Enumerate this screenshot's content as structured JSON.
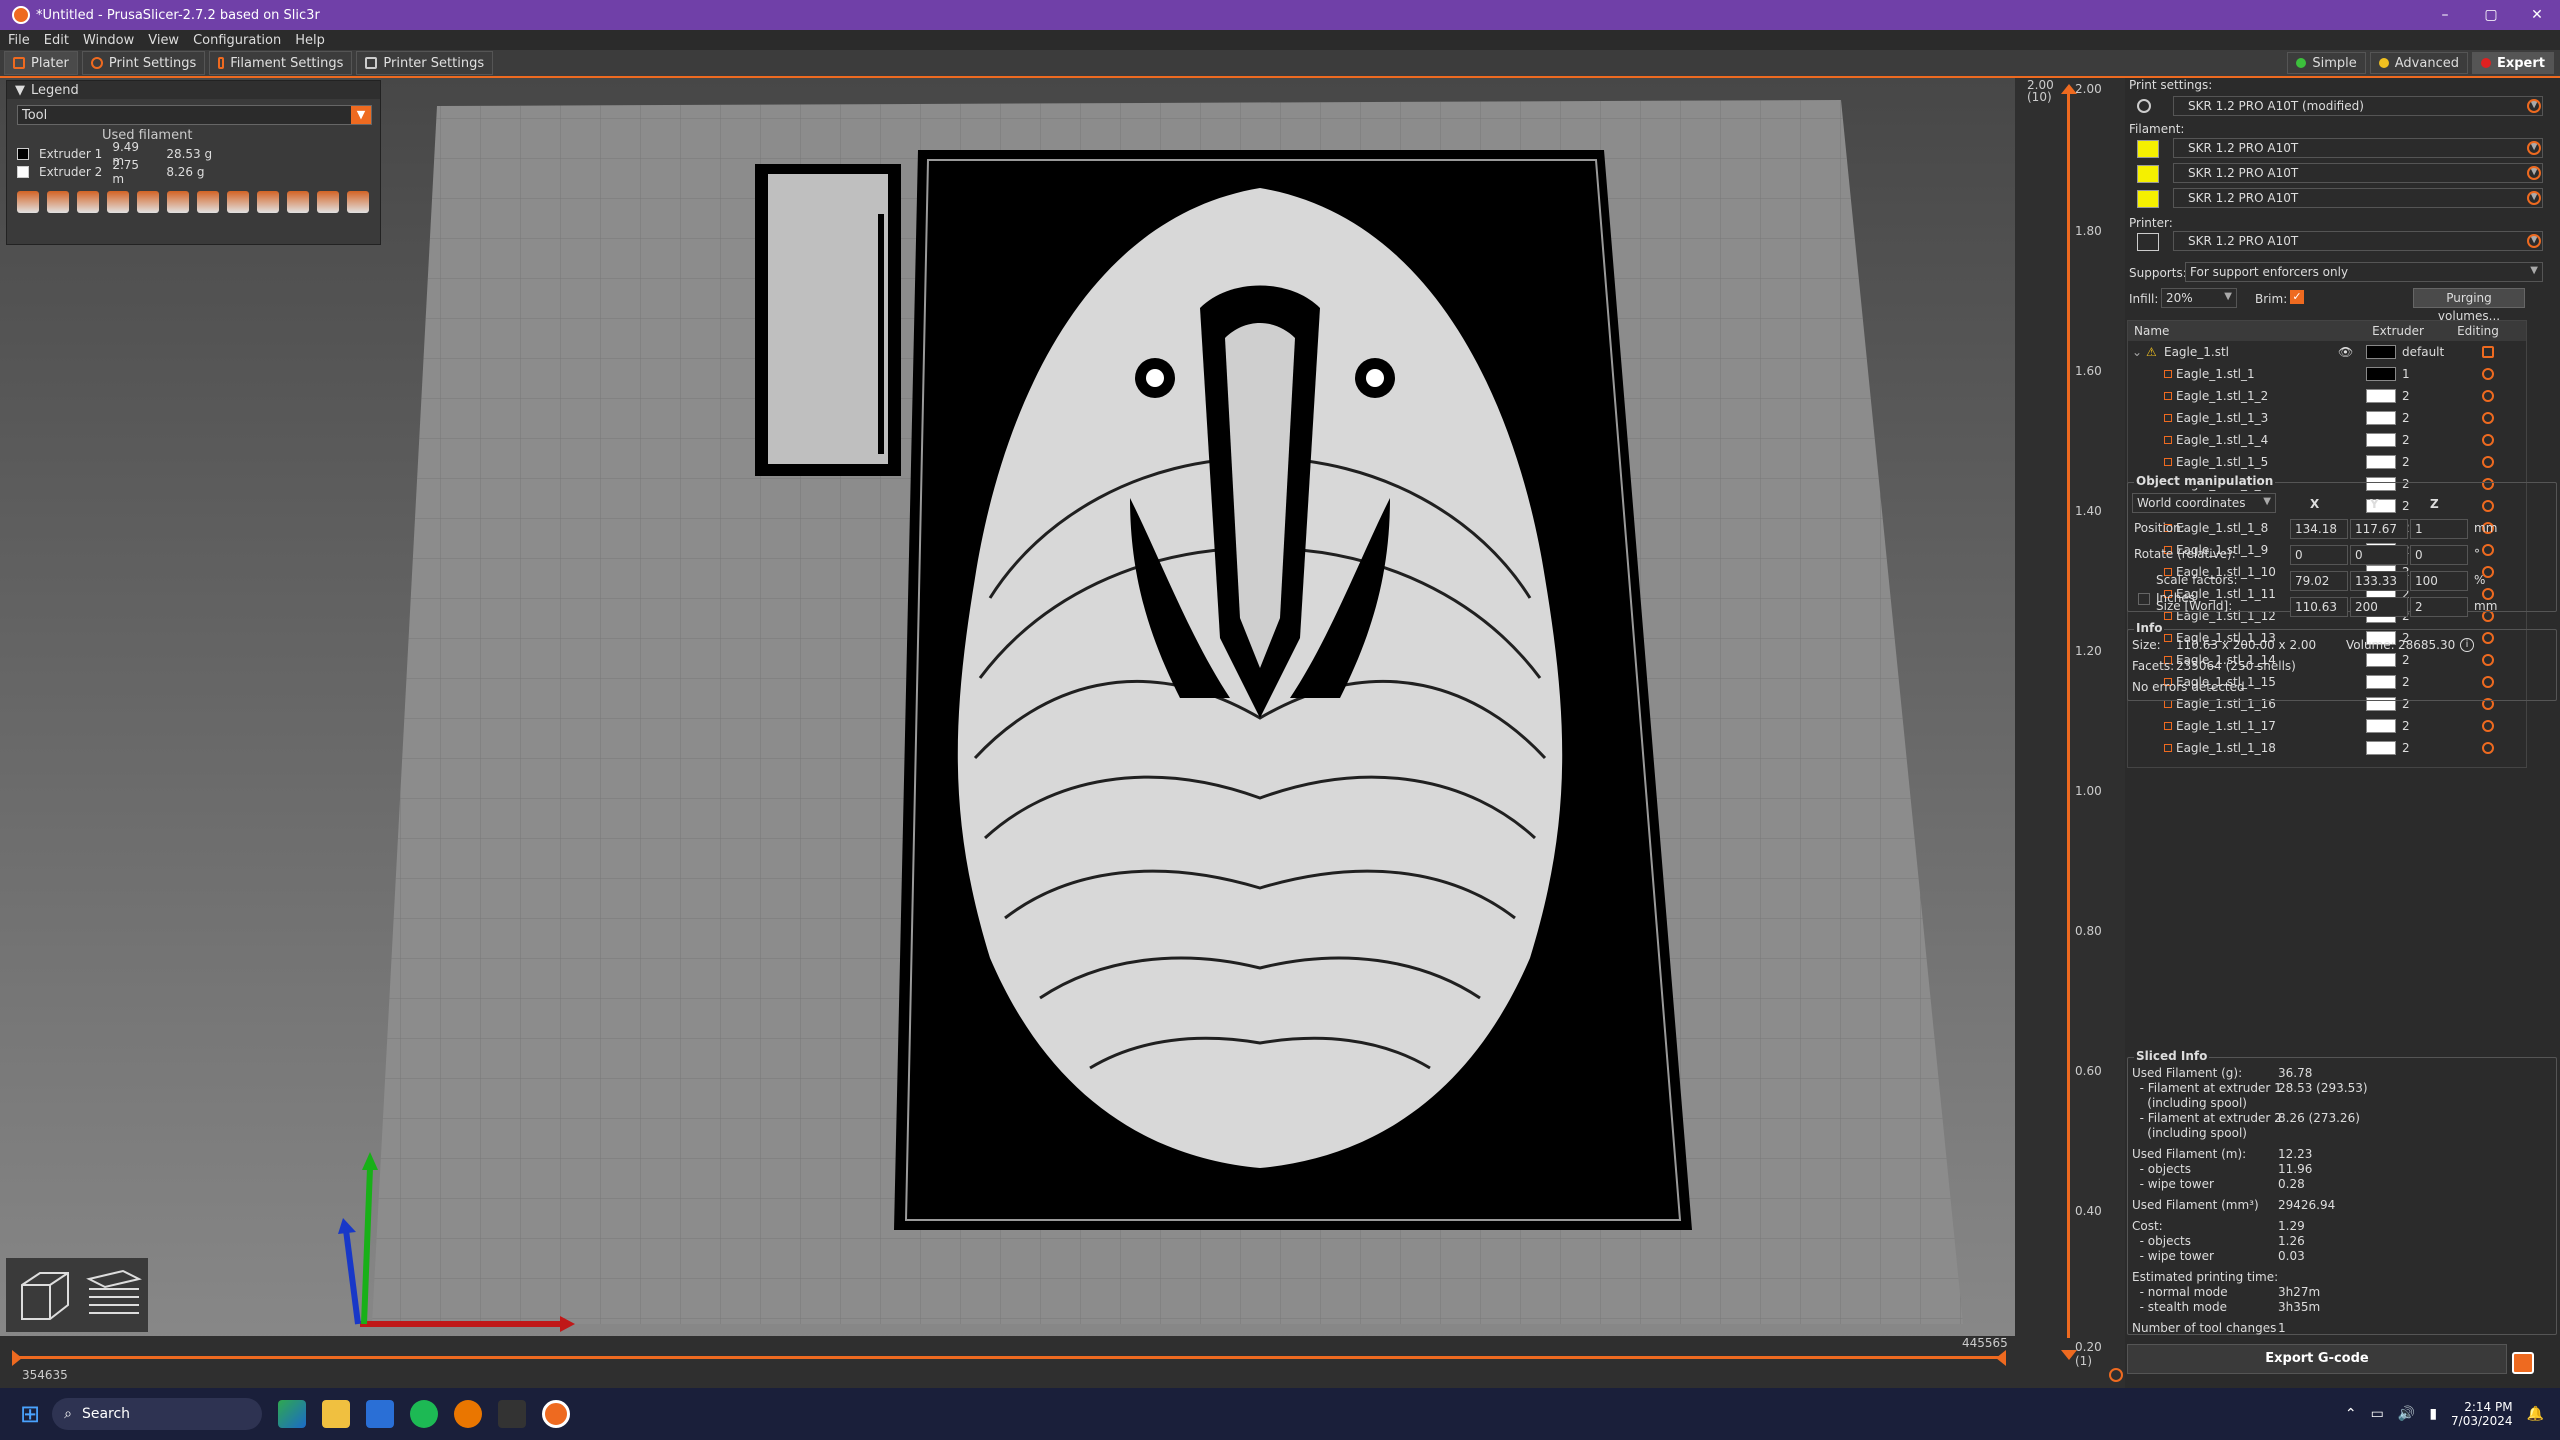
{
  "window": {
    "title": "*Untitled - PrusaSlicer-2.7.2 based on Slic3r",
    "minimize": "–",
    "maximize": "▢",
    "close": "✕"
  },
  "menu": [
    "File",
    "Edit",
    "Window",
    "View",
    "Configuration",
    "Help"
  ],
  "tabs": [
    {
      "label": "Plater"
    },
    {
      "label": "Print Settings"
    },
    {
      "label": "Filament Settings"
    },
    {
      "label": "Printer Settings"
    }
  ],
  "modes": [
    {
      "label": "Simple",
      "color": "#3cc03c"
    },
    {
      "label": "Advanced",
      "color": "#f0c020"
    },
    {
      "label": "Expert",
      "color": "#e02020"
    }
  ],
  "legend": {
    "title": "Legend",
    "view_type": "Tool",
    "used_filament_label": "Used filament",
    "extruders": [
      {
        "name": "Extruder 1",
        "length": "9.49 m",
        "weight": "28.53 g",
        "color": "#000000"
      },
      {
        "name": "Extruder 2",
        "length": "2.75 m",
        "weight": "8.26 g",
        "color": "#ffffff"
      }
    ]
  },
  "vslider": {
    "top_value": "2.00",
    "top_layer": "(10)",
    "top_handle": "2.00",
    "ticks": [
      "1.80",
      "1.60",
      "1.40",
      "1.20",
      "1.00",
      "0.80",
      "0.60",
      "0.40"
    ],
    "bottom_value": "0.20",
    "bottom_layer": "(1)"
  },
  "hslider": {
    "left_value": "354635",
    "right_value": "445565"
  },
  "sidebar": {
    "print_settings_label": "Print settings:",
    "print_profile": "SKR 1.2 PRO A10T (modified)",
    "filament_label": "Filament:",
    "filaments": [
      {
        "name": "SKR 1.2 PRO A10T",
        "color": "#f5f000"
      },
      {
        "name": "SKR 1.2 PRO A10T",
        "color": "#f5f000"
      },
      {
        "name": "SKR 1.2 PRO A10T",
        "color": "#f5f000"
      }
    ],
    "printer_label": "Printer:",
    "printer_profile": "SKR 1.2 PRO A10T",
    "supports_label": "Supports:",
    "supports_value": "For support enforcers only",
    "infill_label": "Infill:",
    "infill_value": "20%",
    "brim_label": "Brim:",
    "purging_button": "Purging volumes..."
  },
  "object_list": {
    "columns": [
      "Name",
      "Extruder",
      "Editing"
    ],
    "parent": {
      "name": "Eagle_1.stl",
      "extruder": "default"
    },
    "parts": [
      {
        "name": "Eagle_1.stl_1",
        "extruder": "1",
        "color": "#000000"
      },
      {
        "name": "Eagle_1.stl_1_2",
        "extruder": "2",
        "color": "#ffffff"
      },
      {
        "name": "Eagle_1.stl_1_3",
        "extruder": "2",
        "color": "#ffffff"
      },
      {
        "name": "Eagle_1.stl_1_4",
        "extruder": "2",
        "color": "#ffffff"
      },
      {
        "name": "Eagle_1.stl_1_5",
        "extruder": "2",
        "color": "#ffffff"
      },
      {
        "name": "Eagle_1.stl_1_6",
        "extruder": "2",
        "color": "#ffffff"
      },
      {
        "name": "Eagle_1.stl_1_7",
        "extruder": "2",
        "color": "#ffffff"
      },
      {
        "name": "Eagle_1.stl_1_8",
        "extruder": "2",
        "color": "#ffffff"
      },
      {
        "name": "Eagle_1.stl_1_9",
        "extruder": "2",
        "color": "#ffffff"
      },
      {
        "name": "Eagle_1.stl_1_10",
        "extruder": "2",
        "color": "#ffffff"
      },
      {
        "name": "Eagle_1.stl_1_11",
        "extruder": "2",
        "color": "#ffffff"
      },
      {
        "name": "Eagle_1.stl_1_12",
        "extruder": "2",
        "color": "#ffffff"
      },
      {
        "name": "Eagle_1.stl_1_13",
        "extruder": "2",
        "color": "#ffffff"
      },
      {
        "name": "Eagle_1.stl_1_14",
        "extruder": "2",
        "color": "#ffffff"
      },
      {
        "name": "Eagle_1.stl_1_15",
        "extruder": "2",
        "color": "#ffffff"
      },
      {
        "name": "Eagle_1.stl_1_16",
        "extruder": "2",
        "color": "#ffffff"
      },
      {
        "name": "Eagle_1.stl_1_17",
        "extruder": "2",
        "color": "#ffffff"
      },
      {
        "name": "Eagle_1.stl_1_18",
        "extruder": "2",
        "color": "#ffffff"
      }
    ]
  },
  "object_manipulation": {
    "title": "Object manipulation",
    "coord_system": "World coordinates",
    "axes": [
      "X",
      "Y",
      "Z"
    ],
    "rows": [
      {
        "label": "Position:",
        "values": [
          "134.18",
          "117.67",
          "1"
        ],
        "unit": "mm"
      },
      {
        "label": "Rotate (relative):",
        "values": [
          "0",
          "0",
          "0"
        ],
        "unit": "°"
      },
      {
        "label": "Scale factors:",
        "values": [
          "79.02",
          "133.33",
          "100"
        ],
        "unit": "%"
      },
      {
        "label": "Size [World]:",
        "values": [
          "110.63",
          "200",
          "2"
        ],
        "unit": "mm"
      }
    ],
    "inches_label": "Inches"
  },
  "info": {
    "title": "Info",
    "size_label": "Size:",
    "size_value": "110.63 x 200.00 x 2.00",
    "volume_label": "Volume:",
    "volume_value": "28685.30",
    "facets_label": "Facets:",
    "facets_value": "235064 (250 shells)",
    "errors": "No errors detected"
  },
  "sliced_info": {
    "title": "Sliced Info",
    "rows": [
      {
        "label": "Used Filament (g):",
        "value": "36.78"
      },
      {
        "label": "  - Filament at extruder 1",
        "value": "28.53 (293.53)"
      },
      {
        "label": "    (including spool)",
        "value": ""
      },
      {
        "label": "  - Filament at extruder 2",
        "value": "8.26 (273.26)"
      },
      {
        "label": "    (including spool)",
        "value": ""
      },
      {
        "label": "Used Filament (m):",
        "value": "12.23"
      },
      {
        "label": "  - objects",
        "value": "11.96"
      },
      {
        "label": "  - wipe tower",
        "value": "0.28"
      },
      {
        "label": "Used Filament (mm³)",
        "value": "29426.94"
      },
      {
        "label": "Cost:",
        "value": "1.29"
      },
      {
        "label": "  - objects",
        "value": "1.26"
      },
      {
        "label": "  - wipe tower",
        "value": "0.03"
      },
      {
        "label": "Estimated printing time:",
        "value": ""
      },
      {
        "label": "  - normal mode",
        "value": "3h27m"
      },
      {
        "label": "  - stealth mode",
        "value": "3h35m"
      },
      {
        "label": "Number of tool changes",
        "value": "1"
      }
    ]
  },
  "export_button": "Export G-code",
  "taskbar": {
    "search": "Search",
    "time": "2:14 PM",
    "date": "7/03/2024"
  }
}
